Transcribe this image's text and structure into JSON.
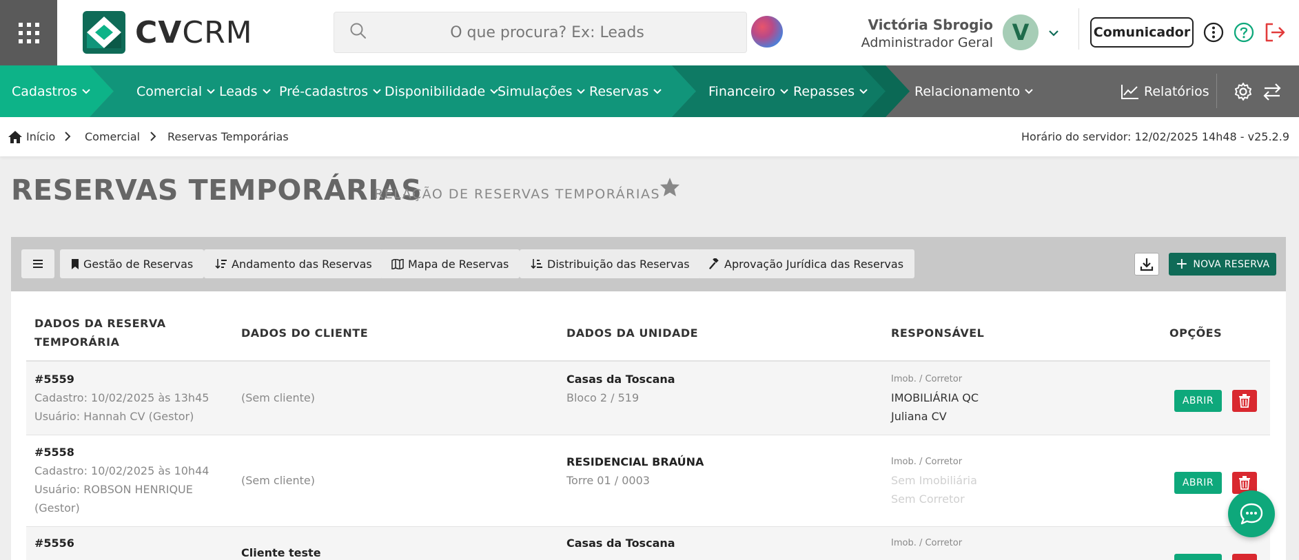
{
  "app": {
    "logo_bold": "CV",
    "logo_light": "CRM"
  },
  "search": {
    "placeholder": "O que procura? Ex: Leads"
  },
  "user": {
    "name": "Victória Sbrogio",
    "role": "Administrador Geral",
    "initial": "V"
  },
  "header": {
    "comunicador_label": "Comunicador"
  },
  "nav": {
    "items": [
      {
        "label": "Cadastros"
      },
      {
        "label": "Comercial"
      },
      {
        "label": "Leads"
      },
      {
        "label": "Pré-cadastros"
      },
      {
        "label": "Disponibilidade"
      },
      {
        "label": "Simulações"
      },
      {
        "label": "Reservas"
      },
      {
        "label": "Financeiro"
      },
      {
        "label": "Repasses"
      },
      {
        "label": "Relacionamento"
      }
    ],
    "reports_label": "Relatórios"
  },
  "breadcrumb": {
    "home": "Início",
    "section": "Comercial",
    "current": "Reservas Temporárias"
  },
  "server_time": "Horário do servidor: 12/02/2025 14h48 - v25.2.9",
  "page": {
    "title": "RESERVAS TEMPORÁRIAS",
    "subtitle": "RELAÇÃO DE RESERVAS TEMPORÁRIAS"
  },
  "toolbar": {
    "tabs": [
      {
        "label": "Gestão de Reservas",
        "icon": "bookmark-icon"
      },
      {
        "label": "Andamento das Reservas",
        "icon": "sort-icon"
      },
      {
        "label": "Mapa de Reservas",
        "icon": "map-icon"
      },
      {
        "label": "Distribuição das Reservas",
        "icon": "sort-icon"
      },
      {
        "label": "Aprovação Jurídica das Reservas",
        "icon": "gavel-icon"
      }
    ],
    "new_label": "NOVA RESERVA"
  },
  "table": {
    "headers": {
      "reserva_line1": "DADOS DA RESERVA",
      "reserva_line2": "TEMPORÁRIA",
      "cliente": "DADOS DO CLIENTE",
      "unidade": "DADOS DA UNIDADE",
      "responsavel": "RESPONSÁVEL",
      "opcoes": "OPÇÕES"
    },
    "open_label": "ABRIR",
    "rows": [
      {
        "id": "#5559",
        "cadastro": "Cadastro: 10/02/2025 às 13h45",
        "usuario": "Usuário: Hannah CV (Gestor)",
        "cliente": "(Sem cliente)",
        "empreendimento": "Casas da Toscana",
        "unidade": "Bloco 2 / 519",
        "resp_label": "Imob. / Corretor",
        "imobiliaria": "IMOBILIÁRIA QC",
        "corretor": "Juliana CV"
      },
      {
        "id": "#5558",
        "cadastro": "Cadastro: 10/02/2025 às 10h44",
        "usuario_line1": "Usuário: ROBSON HENRIQUE",
        "usuario_line2": "(Gestor)",
        "cliente": "(Sem cliente)",
        "empreendimento": "RESIDENCIAL BRAÚNA",
        "unidade": "Torre 01 / 0003",
        "resp_label": "Imob. / Corretor",
        "imobiliaria": "Sem Imobiliária",
        "corretor": "Sem Corretor"
      },
      {
        "id": "#5556",
        "cliente": "Cliente teste",
        "empreendimento": "Casas da Toscana",
        "resp_label": "Imob. / Corretor"
      }
    ]
  },
  "colors": {
    "brand_green": "#0f6b57",
    "nav_light": "#0db388",
    "nav_mid": "#11957a",
    "nav_dark": "#0e7a64",
    "nav_darker": "#0b6955",
    "open_green": "#0ea87b",
    "delete_red": "#d9282f"
  }
}
